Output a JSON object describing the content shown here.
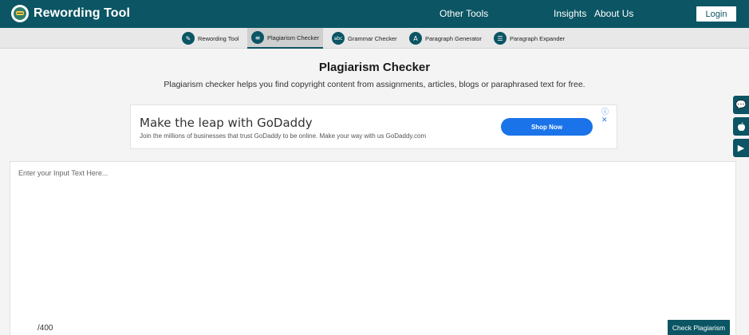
{
  "header": {
    "brand": "Rewording Tool",
    "links": [
      "Other Tools",
      "Insights",
      "About Us"
    ],
    "login_label": "Login"
  },
  "subnav": {
    "tools": [
      {
        "label": "Rewording Tool",
        "icon": "edit-icon",
        "glyph": "✎"
      },
      {
        "label": "Plagiarism Checker",
        "icon": "document-search-icon",
        "glyph": "≡"
      },
      {
        "label": "Grammar Checker",
        "icon": "abc-icon",
        "glyph": "abc"
      },
      {
        "label": "Paragraph Generator",
        "icon": "text-generate-icon",
        "glyph": "A"
      },
      {
        "label": "Paragraph Expander",
        "icon": "list-expand-icon",
        "glyph": "☰"
      }
    ],
    "active": "Plagiarism Checker"
  },
  "page": {
    "title": "Plagiarism Checker",
    "subtitle": "Plagiarism checker helps you find copyright content from assignments, articles, blogs or paraphrased text for free."
  },
  "ad": {
    "headline": "Make the leap with GoDaddy",
    "description": "Join the millions of businesses that trust GoDaddy to be online. Make your way with us GoDaddy.com",
    "button_label": "Shop Now",
    "info_glyph": "ⓘ ✕"
  },
  "side_buttons": [
    {
      "icon": "chat-icon",
      "glyph": "💬"
    },
    {
      "icon": "apple-icon",
      "glyph": ""
    },
    {
      "icon": "play-store-icon",
      "glyph": "▶"
    }
  ],
  "editor": {
    "placeholder": "Enter your Input Text Here...",
    "value": "",
    "counter": "/400",
    "submit_label": "Check Plagiarism"
  },
  "colors": {
    "primary": "#0b5564",
    "ad_button": "#1a73e8",
    "subnav_bg": "#e8e8e8",
    "page_bg": "#f4f4f4"
  }
}
